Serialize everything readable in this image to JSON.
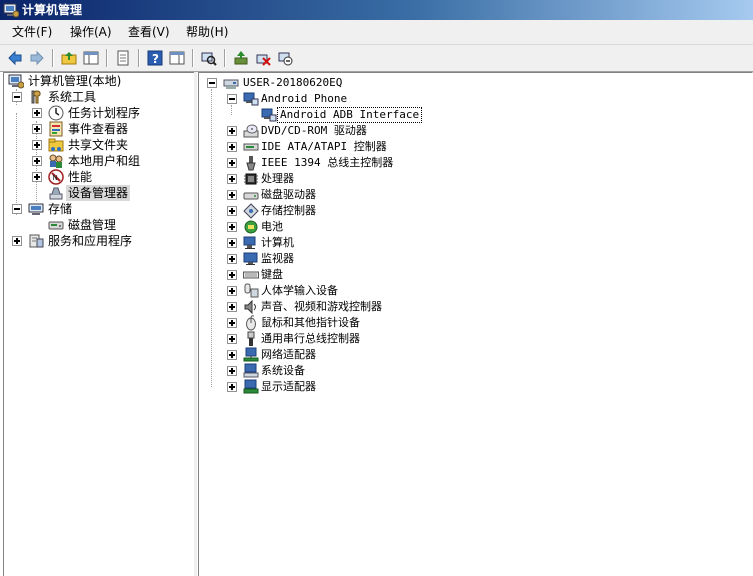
{
  "window": {
    "title": "计算机管理"
  },
  "menu": [
    {
      "label": "文件(F)"
    },
    {
      "label": "操作(A)"
    },
    {
      "label": "查看(V)"
    },
    {
      "label": "帮助(H)"
    }
  ],
  "toolbar": {
    "back": "back-arrow-icon",
    "forward": "forward-arrow-icon",
    "up": "up-folder-icon",
    "show_hide_tree": "console-tree-icon",
    "properties": "properties-icon",
    "help": "help-icon",
    "show_hide_action": "action-pane-icon",
    "scan": "scan-hardware-icon",
    "update_driver": "update-driver-icon",
    "uninstall": "uninstall-icon",
    "disable": "disable-device-icon"
  },
  "left_tree": {
    "root": "计算机管理(本地)",
    "system_tools": "系统工具",
    "task_scheduler": "任务计划程序",
    "event_viewer": "事件查看器",
    "shared_folders": "共享文件夹",
    "local_users": "本地用户和组",
    "performance": "性能",
    "device_manager": "设备管理器",
    "storage": "存储",
    "disk_management": "磁盘管理",
    "services": "服务和应用程序"
  },
  "device_tree": {
    "computer": "USER-20180620EQ",
    "android_phone": "Android Phone",
    "android_adb": "Android ADB Interface",
    "categories": [
      {
        "label": "DVD/CD-ROM 驱动器",
        "icon": "dvd-icon"
      },
      {
        "label": "IDE ATA/ATAPI 控制器",
        "icon": "ide-icon"
      },
      {
        "label": "IEEE 1394 总线主控制器",
        "icon": "firewire-icon"
      },
      {
        "label": "处理器",
        "icon": "processor-icon"
      },
      {
        "label": "磁盘驱动器",
        "icon": "disk-drive-icon"
      },
      {
        "label": "存储控制器",
        "icon": "storage-controller-icon"
      },
      {
        "label": "电池",
        "icon": "battery-icon"
      },
      {
        "label": "计算机",
        "icon": "computer-icon"
      },
      {
        "label": "监视器",
        "icon": "monitor-icon"
      },
      {
        "label": "键盘",
        "icon": "keyboard-icon"
      },
      {
        "label": "人体学输入设备",
        "icon": "hid-icon"
      },
      {
        "label": "声音、视频和游戏控制器",
        "icon": "sound-icon"
      },
      {
        "label": "鼠标和其他指针设备",
        "icon": "mouse-icon"
      },
      {
        "label": "通用串行总线控制器",
        "icon": "usb-icon"
      },
      {
        "label": "网络适配器",
        "icon": "network-adapter-icon"
      },
      {
        "label": "系统设备",
        "icon": "system-device-icon"
      },
      {
        "label": "显示适配器",
        "icon": "display-adapter-icon"
      }
    ]
  }
}
